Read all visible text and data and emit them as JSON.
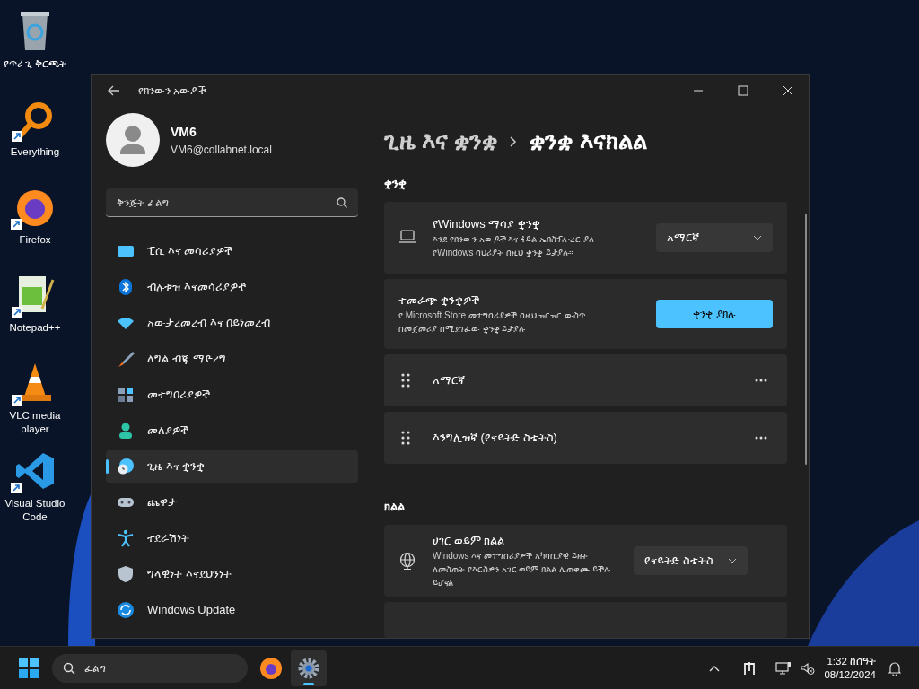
{
  "desktop_icons": [
    {
      "kind": "recycle",
      "label": "የጥራጊ ቅርጫት",
      "shortcut": false
    },
    {
      "kind": "everything",
      "label": "Everything",
      "shortcut": true
    },
    {
      "kind": "firefox",
      "label": "Firefox",
      "shortcut": true
    },
    {
      "kind": "notepad",
      "label": "Notepad++",
      "shortcut": true
    },
    {
      "kind": "vlc",
      "label": "VLC media player",
      "shortcut": true
    },
    {
      "kind": "vscode",
      "label": "Visual Studio Code",
      "shortcut": true
    }
  ],
  "window": {
    "title": "የክንውን አውዶች",
    "user": {
      "name": "VM6",
      "email": "VM6@collabnet.local"
    },
    "search": {
      "placeholder": "ቅንጅት ፈልግ"
    },
    "nav": [
      {
        "kind": "system",
        "label": "ፒሲ እና መሳሪያዎች",
        "selected": false
      },
      {
        "kind": "bluetooth",
        "label": "ብሉቱዝ እናመሳሪያዎች",
        "selected": false
      },
      {
        "kind": "network",
        "label": "አውታረመረብ እና በይነመረብ",
        "selected": false
      },
      {
        "kind": "brush",
        "label": "ለግል ብጁ ማድረግ",
        "selected": false
      },
      {
        "kind": "apps",
        "label": "መተግበሪያዎች",
        "selected": false
      },
      {
        "kind": "accounts",
        "label": "መለያዎች",
        "selected": false
      },
      {
        "kind": "time",
        "label": "ጊዜ እና ቋንቋ",
        "selected": true
      },
      {
        "kind": "gaming",
        "label": "ጨዋታ",
        "selected": false
      },
      {
        "kind": "access",
        "label": "ተደራሽነት",
        "selected": false
      },
      {
        "kind": "privacy",
        "label": "ግላዊነት እናደህንነት",
        "selected": false
      },
      {
        "kind": "update",
        "label": "Windows Update",
        "selected": false
      }
    ],
    "breadcrumb": [
      "ጊዜ እና ቋንቋ",
      "ቋንቋ እናክልል"
    ],
    "sections": [
      {
        "heading": "ቋንቋ",
        "cards": [
          {
            "kind": "dropdown",
            "title": "የWindows ማሳያ ቋንቋ",
            "description": "እንደ የክንውን አውዶች እና ፋይል ኤክስፕሎረር ያሉ የWindows ባህሪያት በዚህ ቋንቋ ይታያሉ።",
            "value": "አማርኛ"
          },
          {
            "kind": "button",
            "title": "ተመራጭ ቋንቋዎች",
            "description": "የ Microsoft Store መተግበሪያዎች በዚህ ዝርዝር ውስጥ በመጀመሪያ በሚደገፈው ቋንቋ ይታያሉ",
            "button": "ቋንቋ ያክሉ"
          },
          {
            "kind": "language",
            "title": "አማርኛ"
          },
          {
            "kind": "language",
            "title": "እንግሊዝኛ (ዩናይትድ ስቴትስ)"
          }
        ]
      },
      {
        "heading": "ክልል",
        "cards": [
          {
            "kind": "dropdown",
            "title": "ሀገር ወይም ክልል",
            "description": "Windows እና መተግበሪያዎች አካባቢያዊ ይዘት ለመስጠት የእርስዎን አገር ወይም ክልል ሊጠቀሙ ይችሉ ይሆናል",
            "value": "ዩናይትድ ስቴትስ"
          }
        ]
      }
    ]
  },
  "taskbar": {
    "search": {
      "placeholder": "ፈልግ"
    },
    "apps": [
      {
        "kind": "firefox",
        "selected": false
      },
      {
        "kind": "settings",
        "selected": true
      }
    ],
    "time": "1:32 ከሰዓት",
    "date": "08/12/2024"
  }
}
